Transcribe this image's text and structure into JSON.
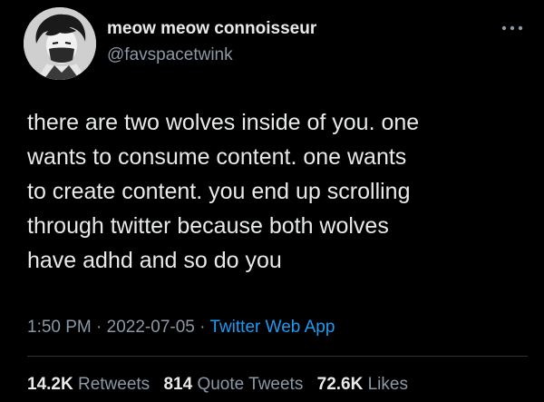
{
  "tweet": {
    "display_name": "meow meow connoisseur",
    "handle": "@favspacetwink",
    "text_lines": [
      "there are two wolves inside of you. one",
      "wants to consume content. one wants",
      "to create content. you end up scrolling",
      "through twitter because both wolves",
      "have adhd and so do you"
    ],
    "time": "1:50 PM",
    "date": "2022-07-05",
    "separator": "·",
    "source": "Twitter Web App",
    "stats": {
      "retweets_count": "14.2K",
      "retweets_label": "Retweets",
      "quotes_count": "814",
      "quotes_label": "Quote Tweets",
      "likes_count": "72.6K",
      "likes_label": "Likes"
    }
  },
  "icons": {
    "more": "more-icon",
    "avatar": "avatar-image"
  },
  "colors": {
    "background": "#000000",
    "primary_text": "#e7e9ea",
    "secondary_text": "#8b98a5",
    "link": "#1d9bf0",
    "divider": "#2f3336"
  }
}
